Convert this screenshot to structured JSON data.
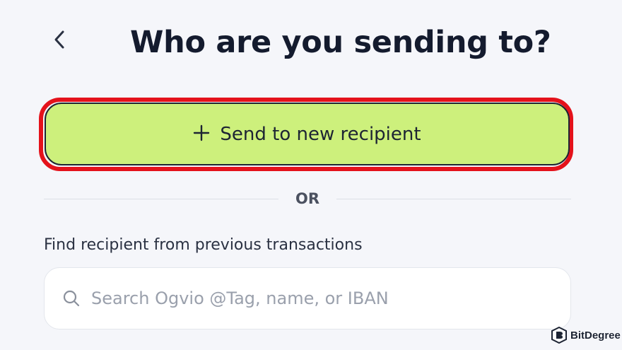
{
  "header": {
    "back_icon": "chevron-left-icon",
    "title": "Who are you sending to?"
  },
  "new_recipient": {
    "icon": "plus-icon",
    "label": "Send to new recipient",
    "highlight_color": "#e4121b",
    "button_color": "#cdf07c"
  },
  "divider": {
    "label": "OR"
  },
  "previous": {
    "label": "Find recipient from previous transactions"
  },
  "search": {
    "icon": "search-icon",
    "placeholder": "Search Ogvio @Tag, name, or IBAN",
    "value": ""
  },
  "watermark": {
    "icon": "bitdegree-logo-icon",
    "text": "BitDegree"
  }
}
